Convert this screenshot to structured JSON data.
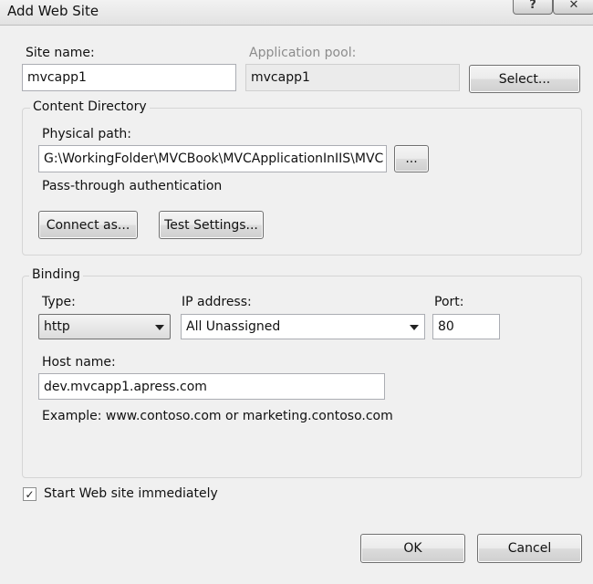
{
  "window": {
    "title": "Add Web Site",
    "help_glyph": "?",
    "close_glyph": "✕"
  },
  "site": {
    "name_label": "Site name:",
    "name_value": "mvcapp1",
    "pool_label": "Application pool:",
    "pool_value": "mvcapp1",
    "select_button": "Select..."
  },
  "content_directory": {
    "title": "Content Directory",
    "physical_path_label": "Physical path:",
    "physical_path_value": "G:\\WorkingFolder\\MVCBook\\MVCApplicationInIIS\\MVC",
    "browse_button": "...",
    "passthrough_label": "Pass-through authentication",
    "connect_as_button": "Connect as...",
    "test_settings_button": "Test Settings..."
  },
  "binding": {
    "title": "Binding",
    "type_label": "Type:",
    "type_value": "http",
    "ip_label": "IP address:",
    "ip_value": "All Unassigned",
    "port_label": "Port:",
    "port_value": "80",
    "host_label": "Host name:",
    "host_value": "dev.mvcapp1.apress.com",
    "example_text": "Example: www.contoso.com or marketing.contoso.com"
  },
  "start_immediately": {
    "label": "Start Web site immediately",
    "checked": true,
    "check_glyph": "✓"
  },
  "footer": {
    "ok_button": "OK",
    "cancel_button": "Cancel"
  }
}
